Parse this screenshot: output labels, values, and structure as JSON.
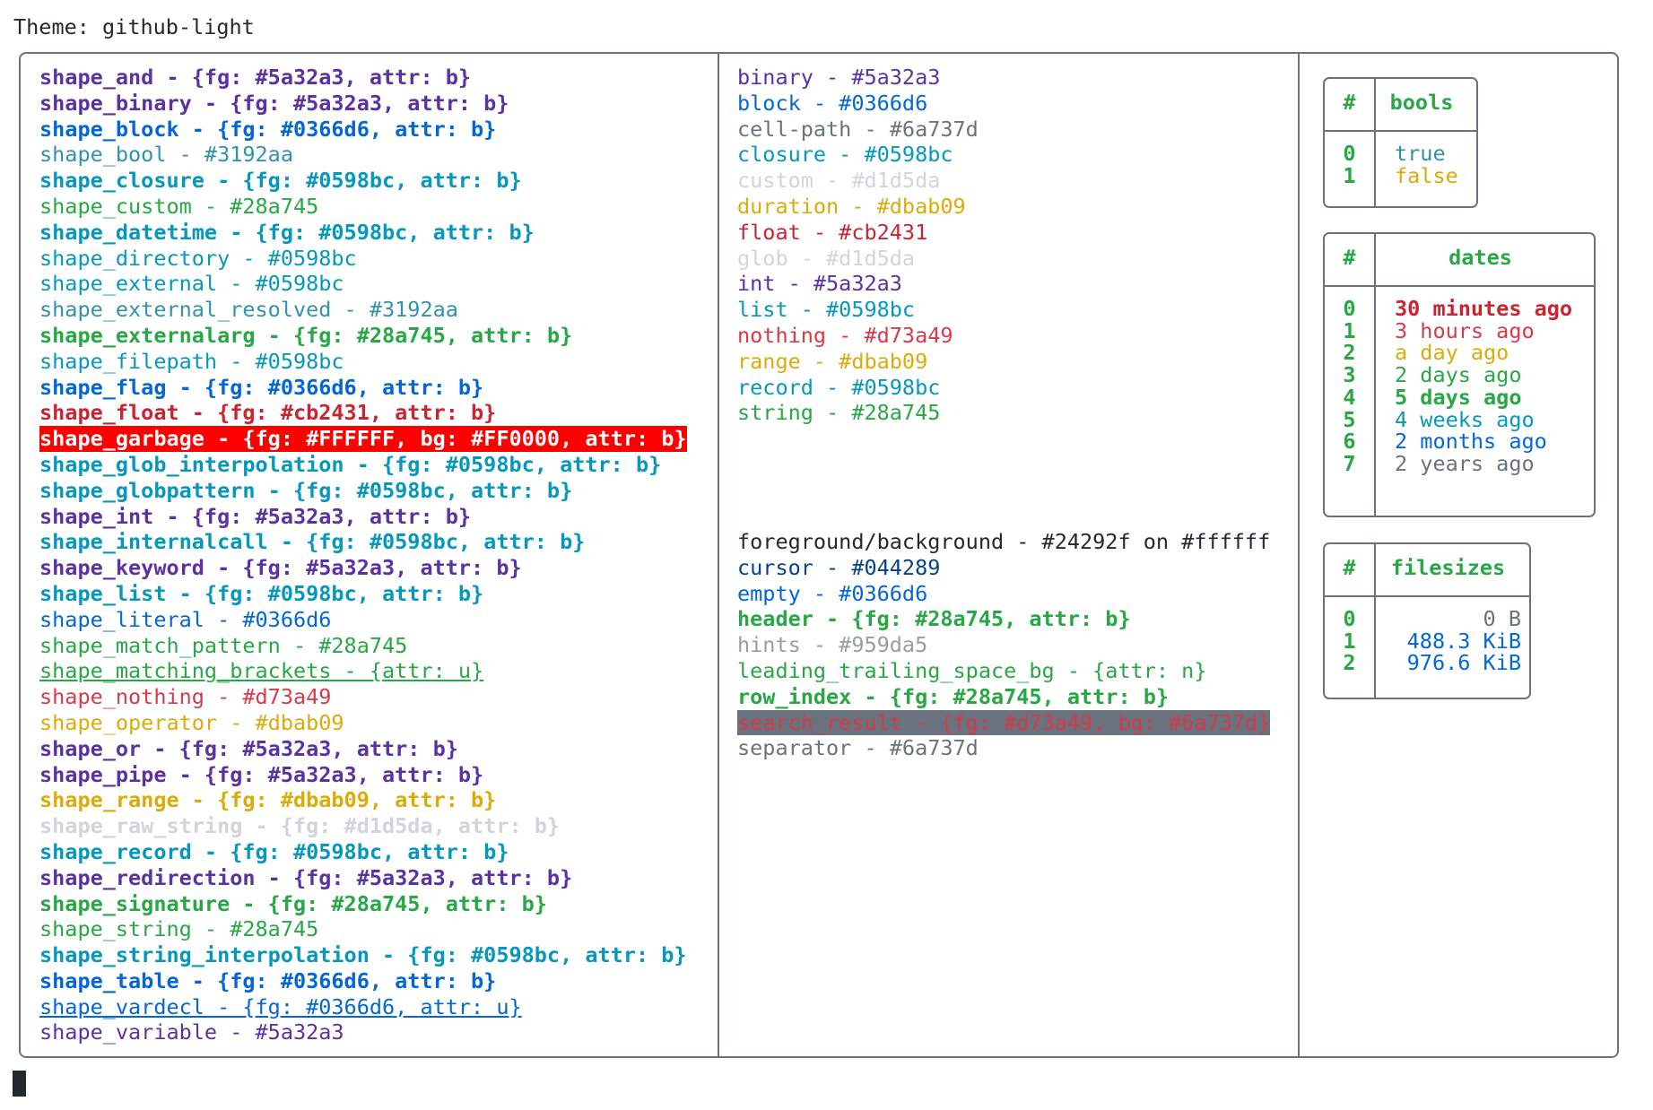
{
  "theme_title": "Theme: github-light",
  "shapes": [
    {
      "text": "shape_and - {fg: #5a32a3, attr: b}",
      "fg": "#5a32a3",
      "bold": true
    },
    {
      "text": "shape_binary - {fg: #5a32a3, attr: b}",
      "fg": "#5a32a3",
      "bold": true
    },
    {
      "text": "shape_block - {fg: #0366d6, attr: b}",
      "fg": "#0366d6",
      "bold": true
    },
    {
      "text": "shape_bool - #3192aa",
      "fg": "#3192aa"
    },
    {
      "text": "shape_closure - {fg: #0598bc, attr: b}",
      "fg": "#0598bc",
      "bold": true
    },
    {
      "text": "shape_custom - #28a745",
      "fg": "#28a745"
    },
    {
      "text": "shape_datetime - {fg: #0598bc, attr: b}",
      "fg": "#0598bc",
      "bold": true
    },
    {
      "text": "shape_directory - #0598bc",
      "fg": "#0598bc"
    },
    {
      "text": "shape_external - #0598bc",
      "fg": "#0598bc"
    },
    {
      "text": "shape_external_resolved - #3192aa",
      "fg": "#3192aa"
    },
    {
      "text": "shape_externalarg - {fg: #28a745, attr: b}",
      "fg": "#28a745",
      "bold": true
    },
    {
      "text": "shape_filepath - #0598bc",
      "fg": "#0598bc"
    },
    {
      "text": "shape_flag - {fg: #0366d6, attr: b}",
      "fg": "#0366d6",
      "bold": true
    },
    {
      "text": "shape_float - {fg: #cb2431, attr: b}",
      "fg": "#cb2431",
      "bold": true
    },
    {
      "text": "shape_garbage - {fg: #FFFFFF, bg: #FF0000, attr: b}",
      "fg": "#FFFFFF",
      "bg": "#FF0000",
      "bold": true
    },
    {
      "text": "shape_glob_interpolation - {fg: #0598bc, attr: b}",
      "fg": "#0598bc",
      "bold": true
    },
    {
      "text": "shape_globpattern - {fg: #0598bc, attr: b}",
      "fg": "#0598bc",
      "bold": true
    },
    {
      "text": "shape_int - {fg: #5a32a3, attr: b}",
      "fg": "#5a32a3",
      "bold": true
    },
    {
      "text": "shape_internalcall - {fg: #0598bc, attr: b}",
      "fg": "#0598bc",
      "bold": true
    },
    {
      "text": "shape_keyword - {fg: #5a32a3, attr: b}",
      "fg": "#5a32a3",
      "bold": true
    },
    {
      "text": "shape_list - {fg: #0598bc, attr: b}",
      "fg": "#0598bc",
      "bold": true
    },
    {
      "text": "shape_literal - #0366d6",
      "fg": "#0366d6"
    },
    {
      "text": "shape_match_pattern - #28a745",
      "fg": "#28a745"
    },
    {
      "text": "shape_matching_brackets - {attr: u}",
      "fg": "#28a745",
      "underline": true
    },
    {
      "text": "shape_nothing - #d73a49",
      "fg": "#d73a49"
    },
    {
      "text": "shape_operator - #dbab09",
      "fg": "#dbab09"
    },
    {
      "text": "shape_or - {fg: #5a32a3, attr: b}",
      "fg": "#5a32a3",
      "bold": true
    },
    {
      "text": "shape_pipe - {fg: #5a32a3, attr: b}",
      "fg": "#5a32a3",
      "bold": true
    },
    {
      "text": "shape_range - {fg: #dbab09, attr: b}",
      "fg": "#dbab09",
      "bold": true
    },
    {
      "text": "shape_raw_string - {fg: #d1d5da, attr: b}",
      "fg": "#d1d5da",
      "bold": true
    },
    {
      "text": "shape_record - {fg: #0598bc, attr: b}",
      "fg": "#0598bc",
      "bold": true
    },
    {
      "text": "shape_redirection - {fg: #5a32a3, attr: b}",
      "fg": "#5a32a3",
      "bold": true
    },
    {
      "text": "shape_signature - {fg: #28a745, attr: b}",
      "fg": "#28a745",
      "bold": true
    },
    {
      "text": "shape_string - #28a745",
      "fg": "#28a745"
    },
    {
      "text": "shape_string_interpolation - {fg: #0598bc, attr: b}",
      "fg": "#0598bc",
      "bold": true
    },
    {
      "text": "shape_table - {fg: #0366d6, attr: b}",
      "fg": "#0366d6",
      "bold": true
    },
    {
      "text": "shape_vardecl - {fg: #0366d6, attr: u}",
      "fg": "#0366d6",
      "underline": true
    },
    {
      "text": "shape_variable - #5a32a3",
      "fg": "#5a32a3"
    }
  ],
  "types": [
    {
      "text": "binary - #5a32a3",
      "fg": "#5a32a3"
    },
    {
      "text": "block - #0366d6",
      "fg": "#0366d6"
    },
    {
      "text": "cell-path - #6a737d",
      "fg": "#6a737d"
    },
    {
      "text": "closure - #0598bc",
      "fg": "#0598bc"
    },
    {
      "text": "custom - #d1d5da",
      "fg": "#d1d5da"
    },
    {
      "text": "duration - #dbab09",
      "fg": "#dbab09"
    },
    {
      "text": "float - #cb2431",
      "fg": "#cb2431"
    },
    {
      "text": "glob - #d1d5da",
      "fg": "#d1d5da"
    },
    {
      "text": "int - #5a32a3",
      "fg": "#5a32a3"
    },
    {
      "text": "list - #0598bc",
      "fg": "#0598bc"
    },
    {
      "text": "nothing - #d73a49",
      "fg": "#d73a49"
    },
    {
      "text": "range - #dbab09",
      "fg": "#dbab09"
    },
    {
      "text": "record - #0598bc",
      "fg": "#0598bc"
    },
    {
      "text": "string - #28a745",
      "fg": "#28a745"
    }
  ],
  "ui_colors": [
    {
      "text": "foreground/background - #24292f on #ffffff",
      "fg": "#24292f"
    },
    {
      "text": "cursor - #044289",
      "fg": "#044289"
    },
    {
      "text": "empty - #0366d6",
      "fg": "#0366d6"
    },
    {
      "text": "header - {fg: #28a745, attr: b}",
      "fg": "#28a745",
      "bold": true
    },
    {
      "text": "hints - #959da5",
      "fg": "#959da5"
    },
    {
      "text": "leading_trailing_space_bg - {attr: n}",
      "fg": "#28a745"
    },
    {
      "text": "row_index - {fg: #28a745, attr: b}",
      "fg": "#28a745",
      "bold": true
    },
    {
      "text": "search_result - {fg: #d73a49, bg: #6a737d}",
      "fg": "#d73a49",
      "bg": "#6a737d"
    },
    {
      "text": "separator - #6a737d",
      "fg": "#6a737d"
    }
  ],
  "bools_table": {
    "index_header": "#",
    "header": "bools",
    "index": [
      "0",
      "1"
    ],
    "rows": [
      {
        "text": "true",
        "fg": "#3192aa"
      },
      {
        "text": "false",
        "fg": "#dbab09"
      }
    ]
  },
  "dates_table": {
    "index_header": "#",
    "header": "dates",
    "index": [
      "0",
      "1",
      "2",
      "3",
      "4",
      "5",
      "6",
      "7"
    ],
    "rows": [
      {
        "text": "30 minutes ago",
        "fg": "#cb2431",
        "bold": true
      },
      {
        "text": "3 hours ago",
        "fg": "#d73a49"
      },
      {
        "text": "a day ago",
        "fg": "#dbab09"
      },
      {
        "text": "2 days ago",
        "fg": "#28a745"
      },
      {
        "text": "5 days ago",
        "fg": "#28a745",
        "bold": true
      },
      {
        "text": "4 weeks ago",
        "fg": "#0598bc"
      },
      {
        "text": "2 months ago",
        "fg": "#0366d6"
      },
      {
        "text": "2 years ago",
        "fg": "#6a737d"
      }
    ]
  },
  "filesizes_table": {
    "index_header": "#",
    "header": "filesizes",
    "index": [
      "0",
      "1",
      "2"
    ],
    "rows": [
      {
        "text": "0 B",
        "fg": "#6a737d"
      },
      {
        "text": "488.3 KiB",
        "fg": "#0366d6"
      },
      {
        "text": "976.6 KiB",
        "fg": "#0366d6"
      }
    ]
  },
  "colors": {
    "border": "#6a737d",
    "header": "#28a745",
    "row_index": "#28a745",
    "foreground": "#24292f",
    "background": "#ffffff"
  }
}
